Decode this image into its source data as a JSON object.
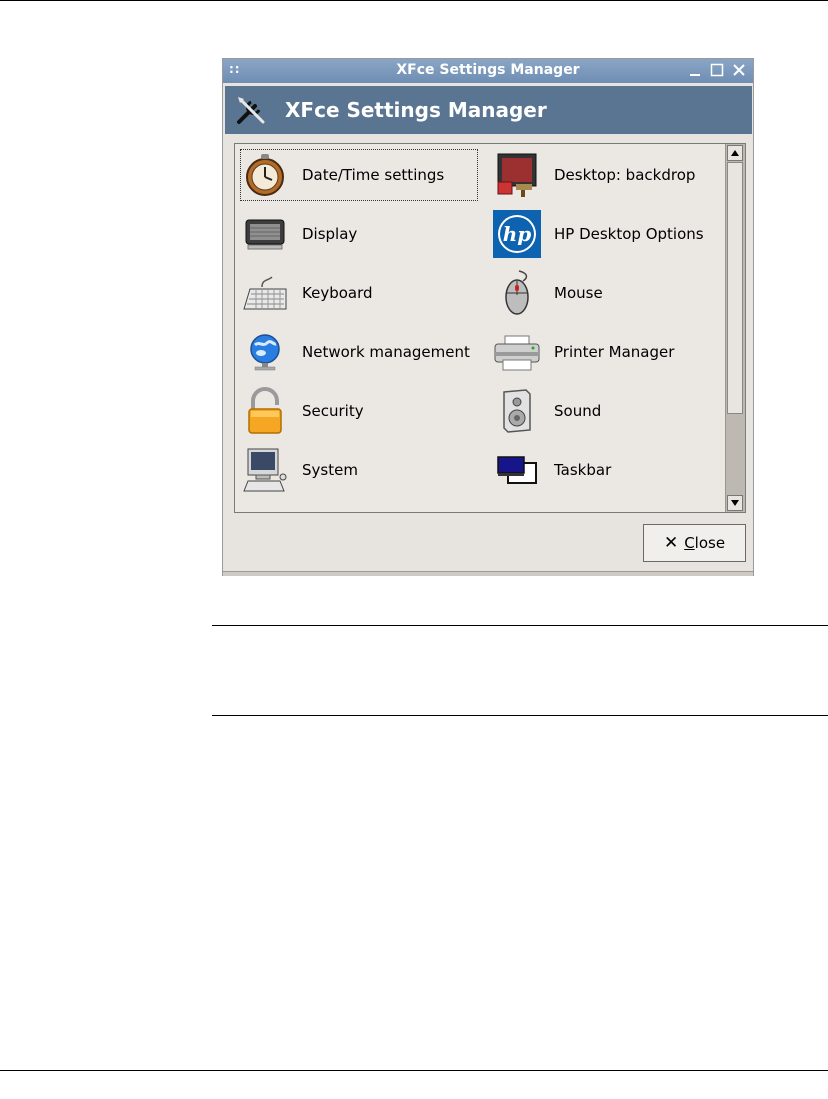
{
  "window": {
    "title": "XFce Settings Manager",
    "header_title": "XFce Settings Manager",
    "grip": "::",
    "titlebar_color": "#7996bb",
    "header_color": "#5a7592"
  },
  "items": [
    {
      "label": "Date/Time settings",
      "icon": "clock-icon"
    },
    {
      "label": "Desktop: backdrop",
      "icon": "backdrop-icon"
    },
    {
      "label": "Display",
      "icon": "monitor-icon"
    },
    {
      "label": "HP Desktop Options",
      "icon": "hp-logo-icon"
    },
    {
      "label": "Keyboard",
      "icon": "keyboard-icon"
    },
    {
      "label": "Mouse",
      "icon": "mouse-icon"
    },
    {
      "label": "Network management",
      "icon": "network-globe-icon"
    },
    {
      "label": "Printer Manager",
      "icon": "printer-icon"
    },
    {
      "label": "Security",
      "icon": "padlock-icon"
    },
    {
      "label": "Sound",
      "icon": "speaker-icon"
    },
    {
      "label": "System",
      "icon": "computer-icon"
    },
    {
      "label": "Taskbar",
      "icon": "taskbar-icon"
    }
  ],
  "selected_item": "Date/Time settings",
  "close_button": {
    "label": "Close",
    "mnemonic": "C"
  }
}
